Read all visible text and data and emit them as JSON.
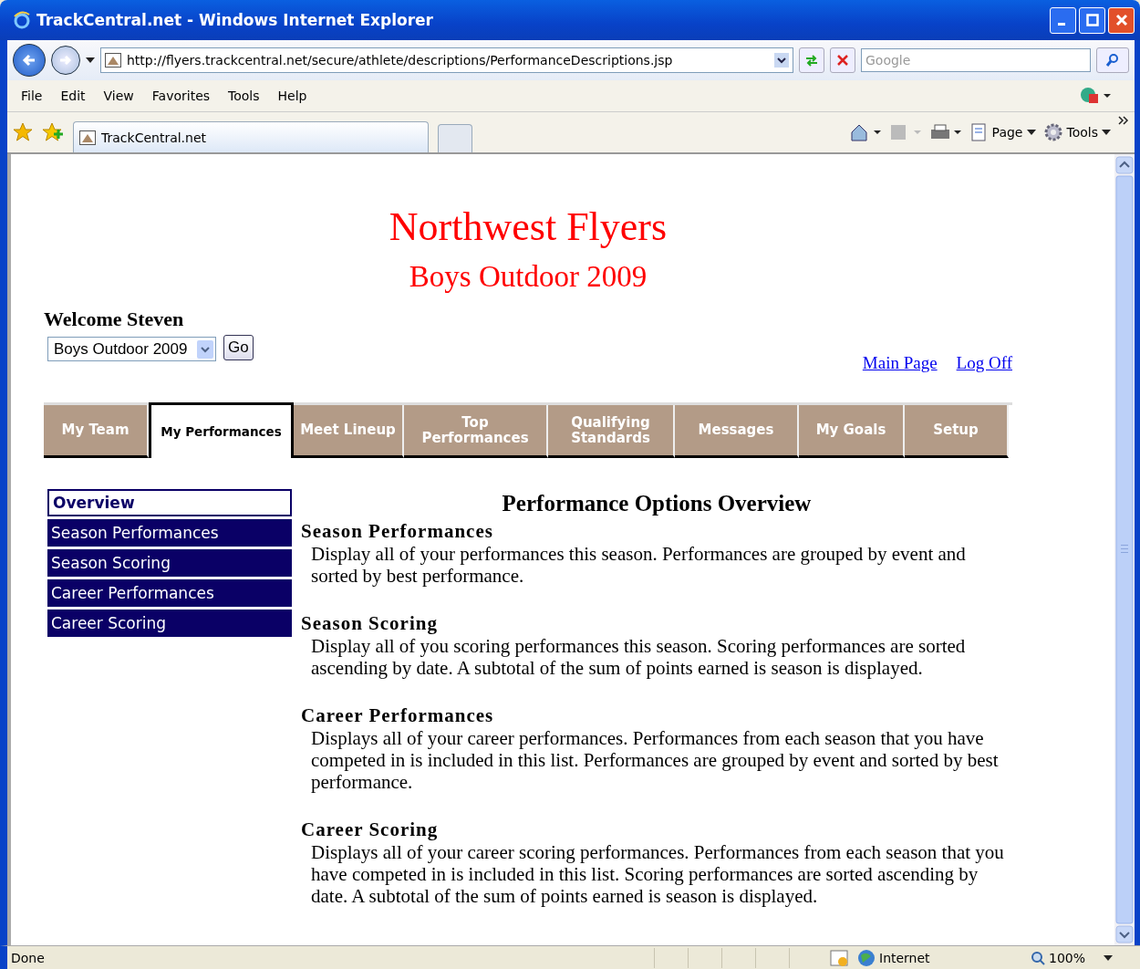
{
  "window": {
    "title": "TrackCentral.net - Windows Internet Explorer"
  },
  "address_bar": {
    "url": "http://flyers.trackcentral.net/secure/athlete/descriptions/PerformanceDescriptions.jsp"
  },
  "search": {
    "placeholder": "Google"
  },
  "menu": [
    "File",
    "Edit",
    "View",
    "Favorites",
    "Tools",
    "Help"
  ],
  "browser_tab": {
    "title": "TrackCentral.net"
  },
  "command_bar": [
    "Page",
    "Tools"
  ],
  "header": {
    "title": "Northwest Flyers",
    "subtitle": "Boys Outdoor 2009"
  },
  "welcome": "Welcome Steven",
  "season_select": {
    "value": "Boys Outdoor 2009"
  },
  "go_button": "Go",
  "links": [
    "Main Page",
    "Log Off"
  ],
  "nav_tabs": [
    {
      "label": "My Team",
      "selected": false
    },
    {
      "label": "My Performances",
      "selected": true
    },
    {
      "label": "Meet Lineup",
      "selected": false
    },
    {
      "label": "Top Performances",
      "selected": false
    },
    {
      "label": "Qualifying Standards",
      "selected": false
    },
    {
      "label": "Messages",
      "selected": false
    },
    {
      "label": "My Goals",
      "selected": false
    },
    {
      "label": "Setup",
      "selected": false
    }
  ],
  "sidebar": {
    "items": [
      {
        "label": "Overview",
        "selected": true
      },
      {
        "label": "Season Performances",
        "selected": false
      },
      {
        "label": "Season Scoring",
        "selected": false
      },
      {
        "label": "Career Performances",
        "selected": false
      },
      {
        "label": "Career Scoring",
        "selected": false
      }
    ]
  },
  "content": {
    "title": "Performance Options Overview",
    "sections": [
      {
        "heading": "Season Performances",
        "body": "Display all of your performances this season. Performances are grouped by event and sorted by best performance."
      },
      {
        "heading": "Season Scoring",
        "body": "Display all of you scoring performances this season. Scoring performances are sorted ascending by date. A subtotal of the sum of points earned is season is displayed."
      },
      {
        "heading": "Career Performances",
        "body": "Displays all of your career performances. Performances from each season that you have competed in is included in this list. Performances are grouped by event and sorted by best performance."
      },
      {
        "heading": "Career Scoring",
        "body": "Displays all of your career scoring performances. Performances from each season that you have competed in is included in this list. Scoring performances are sorted ascending by date. A subtotal of the sum of points earned is season is displayed."
      }
    ]
  },
  "status_bar": {
    "status": "Done",
    "zone": "Internet",
    "zoom": "100%"
  }
}
